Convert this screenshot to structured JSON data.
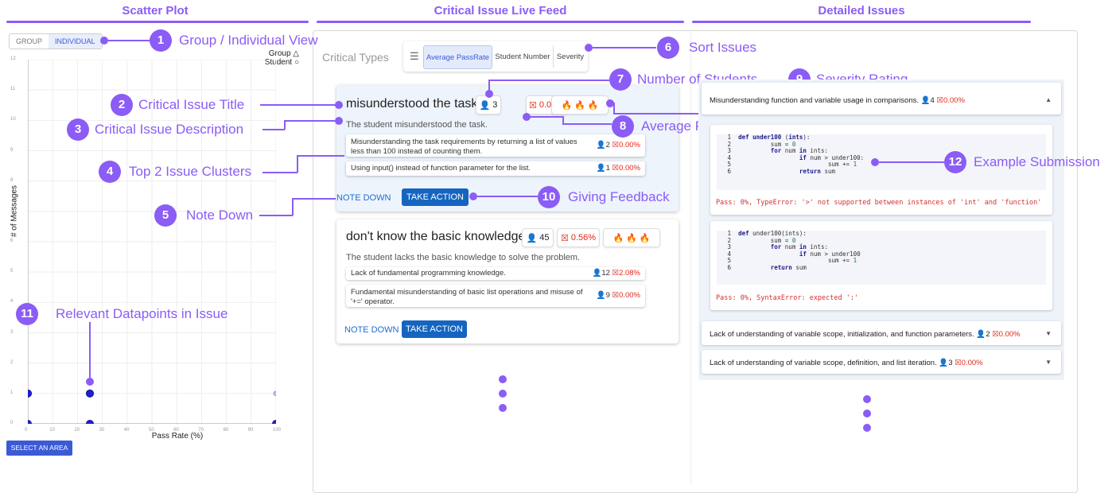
{
  "headers": {
    "scatter": "Scatter Plot",
    "feed": "Critical Issue Live Feed",
    "detail": "Detailed Issues"
  },
  "annotations": [
    {
      "n": "1",
      "label": "Group / Individual View"
    },
    {
      "n": "2",
      "label": "Critical Issue Title"
    },
    {
      "n": "3",
      "label": "Critical Issue Description"
    },
    {
      "n": "4",
      "label": "Top 2 Issue Clusters"
    },
    {
      "n": "5",
      "label": "Note Down"
    },
    {
      "n": "6",
      "label": "Sort Issues"
    },
    {
      "n": "7",
      "label": "Number of Students"
    },
    {
      "n": "8",
      "label": "Average Pass Rate"
    },
    {
      "n": "9",
      "label": "Severity Rating"
    },
    {
      "n": "10",
      "label": "Giving Feedback"
    },
    {
      "n": "11",
      "label": "Relevant Datapoints in Issue"
    },
    {
      "n": "12",
      "label": "Example Submission"
    }
  ],
  "scatter": {
    "toggle": {
      "group": "GROUP",
      "individual": "INDIVIDUAL"
    },
    "legend": {
      "group": "Group",
      "student": "Student",
      "group_symbol": "△",
      "student_symbol": "○"
    },
    "select_area": "SELECT AN AREA"
  },
  "chart_data": {
    "type": "scatter",
    "title": "",
    "xlabel": "Pass Rate (%)",
    "ylabel": "# of Messages",
    "xlim": [
      0,
      100
    ],
    "ylim": [
      0,
      12
    ],
    "xticks": [
      "0",
      "10",
      "20",
      "30",
      "40",
      "50",
      "60",
      "70",
      "80",
      "90",
      "100"
    ],
    "yticks": [
      "0",
      "1",
      "2",
      "3",
      "4",
      "5",
      "6",
      "7",
      "8",
      "9",
      "10",
      "11",
      "12"
    ],
    "grid": true,
    "legend": "top-right",
    "series": [
      {
        "name": "Student",
        "points": [
          {
            "x": 0,
            "y": 0
          },
          {
            "x": 25,
            "y": 0
          },
          {
            "x": 100,
            "y": 0
          },
          {
            "x": 0,
            "y": 1
          },
          {
            "x": 25,
            "y": 1
          }
        ]
      },
      {
        "name": "",
        "points": [
          {
            "x": 100,
            "y": 1
          }
        ]
      }
    ],
    "colors": {
      "point": "#1f1fd6",
      "faded": "#b9b9e6"
    }
  },
  "feed": {
    "critical_types": "Critical Types",
    "sort_options": [
      "Average PassRate",
      "Student Number",
      "Severity"
    ],
    "cards": [
      {
        "title": "misunderstood the task",
        "students": "3",
        "pass_rate": "0.00%",
        "description": "The student misunderstood the task.",
        "clusters": [
          {
            "text": "Misunderstanding the task requirements by returning a list of values less than 100 instead of counting them.",
            "students": "2",
            "pass_rate": "0.00%"
          },
          {
            "text": "Using input() instead of function parameter for the list.",
            "students": "1",
            "pass_rate": "0.00%"
          }
        ],
        "note": "NOTE DOWN",
        "action": "TAKE ACTION"
      },
      {
        "title": "don't know the basic knowledge",
        "students": "45",
        "pass_rate": "0.56%",
        "description": "The student lacks the basic knowledge to solve the problem.",
        "clusters": [
          {
            "text": "Lack of fundamental programming knowledge.",
            "students": "12",
            "pass_rate": "2.08%"
          },
          {
            "text": "Fundamental misunderstanding of basic list operations and misuse of '+=' operator.",
            "students": "9",
            "pass_rate": "0.00%"
          }
        ],
        "note": "NOTE DOWN",
        "action": "TAKE ACTION"
      }
    ]
  },
  "detail": {
    "issues": [
      {
        "text": "Misunderstanding function and variable usage in comparisons.",
        "students": "4",
        "pass_rate": "0.00%"
      },
      {
        "text": "Lack of understanding of variable scope, initialization, and function parameters.",
        "students": "2",
        "pass_rate": "0.00%"
      },
      {
        "text": "Lack of understanding of variable scope, definition, and list iteration.",
        "students": "3",
        "pass_rate": "0.00%"
      }
    ],
    "submissions": [
      {
        "error": "Pass: 0%, TypeError: '>' not supported between instances of 'int' and 'function'"
      },
      {
        "error": "Pass: 0%, SyntaxError: expected ':'"
      }
    ]
  },
  "icons": {
    "person": "person-icon",
    "pass": "pass-rate-icon",
    "flame": "flame-icon",
    "sort": "sort-icon",
    "caret_up": "caret-up-icon",
    "caret_down": "caret-down-icon"
  }
}
